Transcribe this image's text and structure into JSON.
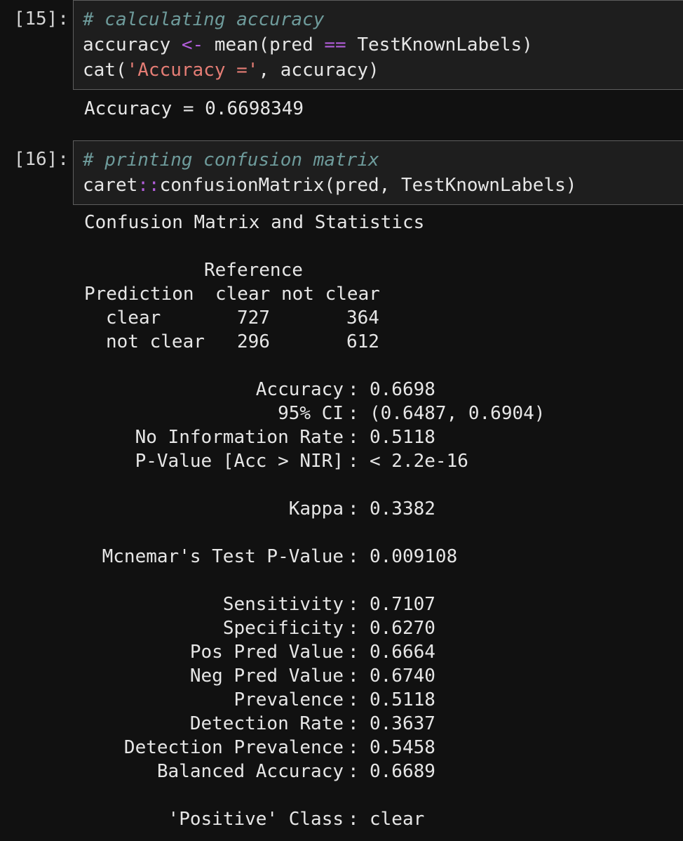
{
  "cells": {
    "cell15": {
      "prompt": "[15]:",
      "comment": "# calculating accuracy",
      "line2": {
        "a": "accuracy ",
        "op": "<-",
        "b": " mean(pred ",
        "op2": "==",
        "c": " TestKnownLabels)"
      },
      "line3": {
        "a": "cat(",
        "str": "'Accuracy ='",
        "b": ", accuracy)"
      },
      "output": "Accuracy = 0.6698349"
    },
    "cell16": {
      "prompt": "[16]:",
      "comment": "# printing confusion matrix",
      "line2": {
        "a": "caret",
        "op": "::",
        "b": "confusionMatrix(pred, TestKnownLabels)"
      },
      "output_title": "Confusion Matrix and Statistics"
    }
  },
  "matrix": {
    "reference_label": "Reference",
    "prediction_label": "Prediction",
    "col_headers": [
      "clear",
      "not clear"
    ],
    "rows": [
      {
        "label": "clear",
        "values": [
          "727",
          "364"
        ]
      },
      {
        "label": "not clear",
        "values": [
          "296",
          "612"
        ]
      }
    ]
  },
  "stats_group1": [
    {
      "label": "Accuracy",
      "value": "0.6698"
    },
    {
      "label": "95% CI",
      "value": "(0.6487, 0.6904)"
    },
    {
      "label": "No Information Rate",
      "value": "0.5118"
    },
    {
      "label": "P-Value [Acc > NIR]",
      "value": "< 2.2e-16"
    }
  ],
  "kappa": {
    "label": "Kappa",
    "value": "0.3382"
  },
  "mcnemar": {
    "label": "Mcnemar's Test P-Value",
    "value": "0.009108"
  },
  "stats_group2": [
    {
      "label": "Sensitivity",
      "value": "0.7107"
    },
    {
      "label": "Specificity",
      "value": "0.6270"
    },
    {
      "label": "Pos Pred Value",
      "value": "0.6664"
    },
    {
      "label": "Neg Pred Value",
      "value": "0.6740"
    },
    {
      "label": "Prevalence",
      "value": "0.5118"
    },
    {
      "label": "Detection Rate",
      "value": "0.3637"
    },
    {
      "label": "Detection Prevalence",
      "value": "0.5458"
    },
    {
      "label": "Balanced Accuracy",
      "value": "0.6689"
    }
  ],
  "positive_class": {
    "label": "'Positive' Class",
    "value": "clear"
  },
  "colors": {
    "background": "#111111",
    "cell_input_bg": "#1e1e1e",
    "comment": "#6e9b9b",
    "operator": "#b25ddb",
    "string": "#e57d75",
    "text": "#e6e6e6"
  }
}
